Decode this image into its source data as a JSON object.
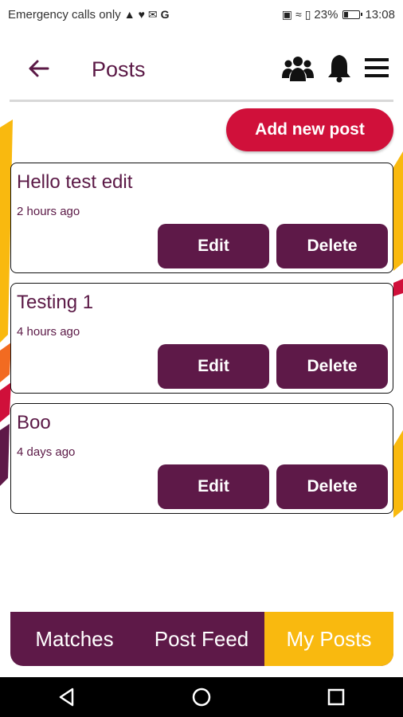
{
  "status_bar": {
    "left_text": "Emergency calls only",
    "battery": "23%",
    "time": "13:08",
    "icons": [
      "navigation-icon",
      "heart-icon",
      "mail-icon",
      "google-icon",
      "nfc-icon",
      "wifi-icon",
      "sim-icon",
      "battery-icon"
    ]
  },
  "app_bar": {
    "title": "Posts",
    "icons": [
      "back-arrow-icon",
      "people-icon",
      "bell-icon",
      "menu-icon"
    ]
  },
  "actions": {
    "add_post_label": "Add new post"
  },
  "posts": [
    {
      "title": "Hello test edit",
      "time": "2 hours ago",
      "edit_label": "Edit",
      "delete_label": "Delete"
    },
    {
      "title": "Testing 1",
      "time": "4 hours ago",
      "edit_label": "Edit",
      "delete_label": "Delete"
    },
    {
      "title": "Boo",
      "time": "4 days ago",
      "edit_label": "Edit",
      "delete_label": "Delete"
    }
  ],
  "tabs": [
    {
      "label": "Matches",
      "active": false
    },
    {
      "label": "Post Feed",
      "active": false
    },
    {
      "label": "My Posts",
      "active": true
    }
  ],
  "nav_bar": {
    "icons": [
      "back-triangle-icon",
      "home-circle-icon",
      "recents-square-icon"
    ]
  },
  "colors": {
    "primary": "#5e1948",
    "accent": "#d0103a",
    "active_tab": "#f9b90f"
  }
}
